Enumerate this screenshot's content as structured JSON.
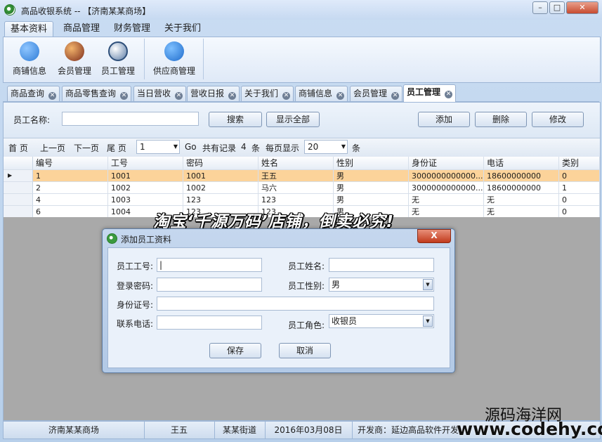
{
  "window": {
    "title": "高品收银系统 -- 【济南某某商场】"
  },
  "menu": [
    "基本资料",
    "商品管理",
    "财务管理",
    "关于我们"
  ],
  "ribbon": {
    "items": [
      "商铺信息",
      "会员管理",
      "员工管理"
    ],
    "supplier": "供应商管理"
  },
  "tabs": [
    "商品查询",
    "商品零售查询",
    "当日营收",
    "营收日报",
    "关于我们",
    "商铺信息",
    "会员管理",
    "员工管理"
  ],
  "search": {
    "label": "员工名称:",
    "value": "",
    "search_btn": "搜索",
    "show_all_btn": "显示全部",
    "add_btn": "添加",
    "delete_btn": "删除",
    "edit_btn": "修改"
  },
  "pager": {
    "first": "首 页",
    "prev": "上一页",
    "next": "下一页",
    "last": "尾 页",
    "page": "1",
    "go": "Go",
    "total_prefix": "共有记录",
    "total": "4",
    "total_suffix": "条",
    "per_page_label": "每页显示",
    "per_page": "20",
    "per_page_suffix": "条"
  },
  "table": {
    "columns": [
      "编号",
      "工号",
      "密码",
      "姓名",
      "性别",
      "身份证",
      "电话",
      "类别"
    ],
    "rows": [
      [
        "1",
        "1001",
        "1001",
        "王五",
        "男",
        "3000000000000...",
        "18600000000",
        "0"
      ],
      [
        "2",
        "1002",
        "1002",
        "马六",
        "男",
        "3000000000000...",
        "18600000000",
        "1"
      ],
      [
        "4",
        "1003",
        "123",
        "123",
        "男",
        "无",
        "无",
        "0"
      ],
      [
        "6",
        "1004",
        "123",
        "123",
        "男",
        "无",
        "无",
        "0"
      ]
    ]
  },
  "dialog": {
    "title": "添加员工资料",
    "close": "X",
    "emp_no_label": "员工工号:",
    "emp_no_value": "|",
    "emp_name_label": "员工姓名:",
    "emp_name_value": "",
    "password_label": "登录密码:",
    "password_value": "",
    "gender_label": "员工性别:",
    "gender_value": "男",
    "id_label": "身份证号:",
    "id_value": "",
    "phone_label": "联系电话:",
    "phone_value": "",
    "role_label": "员工角色:",
    "role_value": "收银员",
    "save_btn": "保存",
    "cancel_btn": "取消"
  },
  "watermark": "淘宝‘千源万码’店铺，倒卖必究!",
  "status": {
    "store": "济南某某商场",
    "user": "王五",
    "address": "某某街道",
    "date": "2016年03月08日",
    "developer": "开发商：延边高品软件开发"
  },
  "brand": {
    "line1": "源码海洋网",
    "line2": "www.codehy.com"
  }
}
